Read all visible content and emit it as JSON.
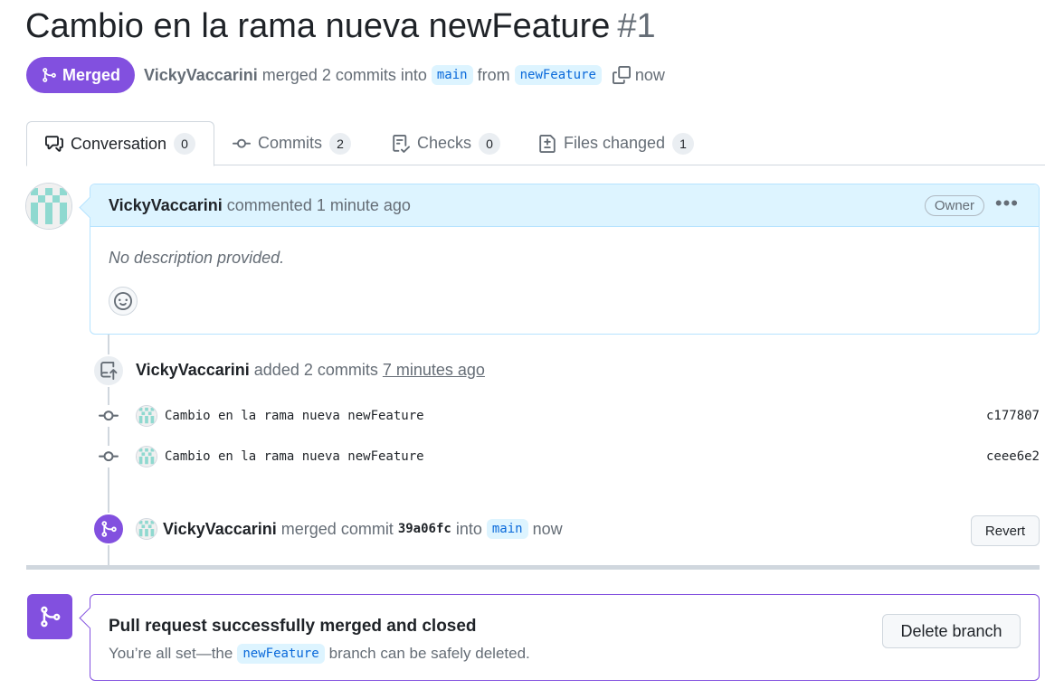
{
  "title": {
    "text": "Cambio en la rama nueva newFeature",
    "number": "#1"
  },
  "summary": {
    "badge": "Merged",
    "author": "VickyVaccarini",
    "action": "merged 2 commits into",
    "base_branch": "main",
    "from_word": "from",
    "head_branch": "newFeature",
    "time": "now"
  },
  "tabs": [
    {
      "label": "Conversation",
      "count": "0",
      "icon": "comment-discussion-icon"
    },
    {
      "label": "Commits",
      "count": "2",
      "icon": "git-commit-icon"
    },
    {
      "label": "Checks",
      "count": "0",
      "icon": "checklist-icon"
    },
    {
      "label": "Files changed",
      "count": "1",
      "icon": "file-diff-icon"
    }
  ],
  "comment": {
    "author": "VickyVaccarini",
    "action": "commented 1 minute ago",
    "role": "Owner",
    "body": "No description provided."
  },
  "push_event": {
    "author": "VickyVaccarini",
    "action": "added 2 commits",
    "time": "7 minutes ago"
  },
  "commits": [
    {
      "message": "Cambio en la rama nueva newFeature",
      "sha": "c177807"
    },
    {
      "message": "Cambio en la rama nueva newFeature",
      "sha": "ceee6e2"
    }
  ],
  "merge_event": {
    "author": "VickyVaccarini",
    "action": "merged commit",
    "sha": "39a06fc",
    "into_word": "into",
    "branch": "main",
    "time": "now",
    "revert_label": "Revert"
  },
  "merge_box": {
    "title": "Pull request successfully merged and closed",
    "sub_prefix": "You’re all set—the",
    "branch": "newFeature",
    "sub_suffix": "branch can be safely deleted.",
    "delete_label": "Delete branch"
  },
  "colors": {
    "merged_purple": "#8250df",
    "link_blue": "#0969da",
    "comment_header_bg": "#ddf4ff",
    "identicon_teal": "#8fd9d0"
  }
}
